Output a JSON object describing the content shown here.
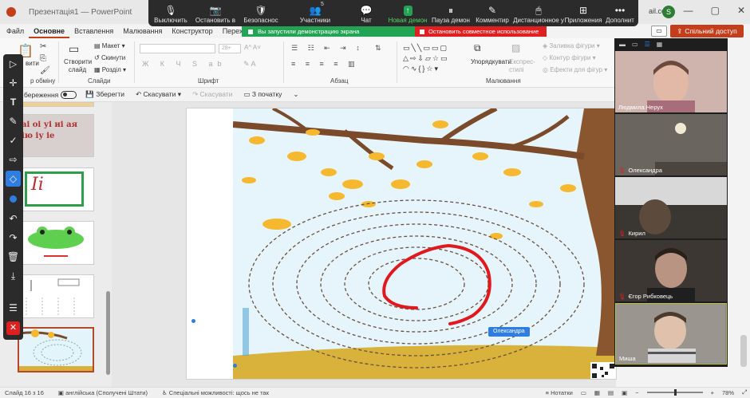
{
  "titlebar": {
    "doc_title": "Презентація1 — PowerPoint",
    "account_suffix": "ail.com",
    "avatar_letter": "S",
    "minimize": "—",
    "maximize": "▢",
    "close": "✕"
  },
  "zoom_toolbar": {
    "items": [
      {
        "icon": "🎙",
        "label": "Выключить"
      },
      {
        "icon": "📷",
        "label": "Остановить в"
      },
      {
        "icon": "🛡",
        "label": "Безопаснос"
      },
      {
        "icon": "👥",
        "label": "Участники",
        "count": "5"
      },
      {
        "icon": "💬",
        "label": "Чат"
      },
      {
        "icon": "↑",
        "label": "Новая демон"
      },
      {
        "icon": "⏸",
        "label": "Пауза демон"
      },
      {
        "icon": "✎",
        "label": "Комментир"
      },
      {
        "icon": "🖱",
        "label": "Дистанционное у"
      },
      {
        "icon": "⊞",
        "label": "Приложения"
      },
      {
        "icon": "•••",
        "label": "Дополнит"
      }
    ],
    "share_banner": "Вы запустили демонстрацию экрана",
    "stop_share": "Остановить совместное использование"
  },
  "menu": {
    "tabs": [
      "Файл",
      "Основне",
      "Вставлення",
      "Малювання",
      "Конструктор",
      "Переход"
    ],
    "active": "Основне",
    "comment_icon": "▭",
    "share_access": "Спільний доступ"
  },
  "ribbon": {
    "clipboard_label": "р обміну",
    "paste_label": "вити",
    "new_slide": "Створити слайд",
    "layout": "Макет",
    "reset": "Скинути",
    "section": "Розділ",
    "slides_label": "Слайди",
    "font_size": "28+",
    "font_label": "Шрифт",
    "paragraph_label": "Абзац",
    "arrange": "Упорядкувати",
    "quick_styles": "Експрес-стилі",
    "fill": "Заливка фігури",
    "outline": "Контур фігури",
    "effects": "Ефекти для фігур",
    "drawing_label": "Малювання"
  },
  "quick_access": {
    "autosave": "береження",
    "save": "Зберегти",
    "undo": "Скасувати",
    "redo": "Скасувати",
    "from_start": "З початку"
  },
  "annotation_tools": {
    "tools": [
      "▷",
      "✛",
      "T",
      "✎",
      "✓",
      "⇨",
      "◇",
      "●",
      "↶",
      "↷",
      "🗑",
      "⤓",
      "☰",
      "✕"
    ]
  },
  "slide": {
    "viewer_tag": "Олександра"
  },
  "thumbnails": {
    "t1_text": "аі оі уі иі ая ію іу іе",
    "t2_letters": "Іі"
  },
  "participants": [
    {
      "name": "Людмила Нерух",
      "muted": false
    },
    {
      "name": "Олександра",
      "muted": true
    },
    {
      "name": "Кирил",
      "muted": true
    },
    {
      "name": "Єгор Рибковець",
      "muted": true
    },
    {
      "name": "Миша",
      "muted": false
    }
  ],
  "status": {
    "slide_of": "Слайд 16 з 16",
    "language": "англійська (Сполучені Штати)",
    "accessibility": "Спеціальні можливості: щось не так",
    "notes": "Нотатки",
    "zoom": "78%"
  }
}
